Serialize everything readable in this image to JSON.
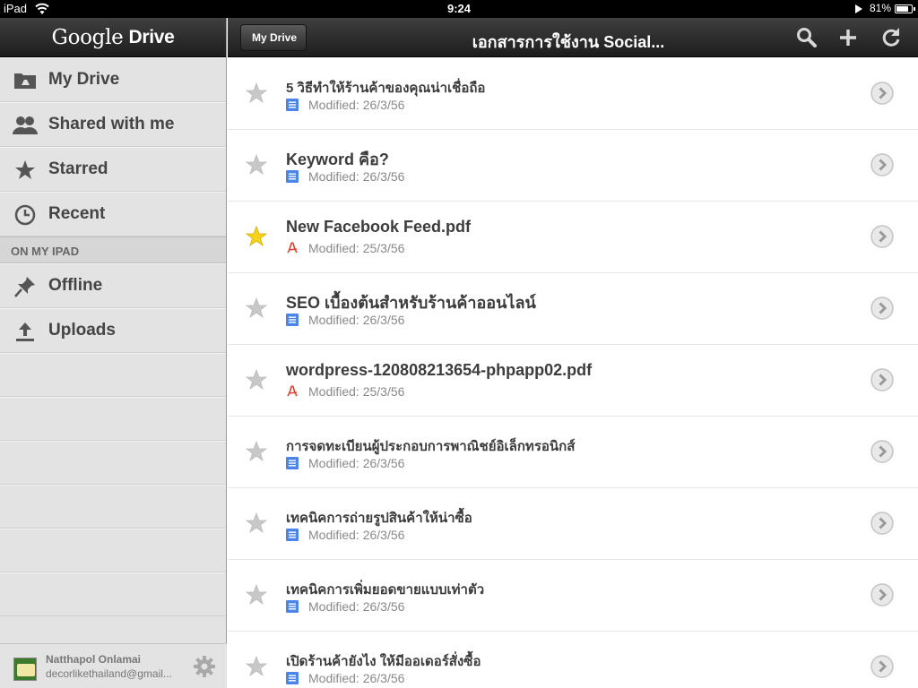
{
  "status": {
    "carrier": "iPad",
    "time": "9:24",
    "battery": "81%",
    "battery_level": 0.81
  },
  "sidebar": {
    "logo_google": "Google",
    "logo_drive": "Drive",
    "items": [
      {
        "label": "My Drive",
        "icon": "drive-folder-icon"
      },
      {
        "label": "Shared with me",
        "icon": "people-icon"
      },
      {
        "label": "Starred",
        "icon": "star-icon"
      },
      {
        "label": "Recent",
        "icon": "clock-icon"
      }
    ],
    "section": "ON MY IPAD",
    "local_items": [
      {
        "label": "Offline",
        "icon": "pin-icon"
      },
      {
        "label": "Uploads",
        "icon": "upload-icon"
      }
    ],
    "user": {
      "name": "Natthapol Onlamai",
      "email": "decorlikethailand@gmail..."
    }
  },
  "topbar": {
    "back_label": "My Drive",
    "title": "เอกสารการใช้งาน Social...",
    "icons": [
      "search-icon",
      "add-icon",
      "refresh-icon"
    ]
  },
  "files": [
    {
      "name": "5 วิธีทำให้ร้านค้าของคุณน่าเชื่อถือ",
      "modified": "Modified: 26/3/56",
      "type": "doc",
      "starred": false,
      "thai": true
    },
    {
      "name": "Keyword คือ?",
      "modified": "Modified: 26/3/56",
      "type": "doc",
      "starred": false,
      "thai": false
    },
    {
      "name": "New Facebook Feed.pdf",
      "modified": "Modified: 25/3/56",
      "type": "pdf",
      "starred": true,
      "thai": false
    },
    {
      "name": "SEO เบื้องต้นสำหรับร้านค้าออนไลน์",
      "modified": "Modified: 26/3/56",
      "type": "doc",
      "starred": false,
      "thai": false
    },
    {
      "name": "wordpress-120808213654-phpapp02.pdf",
      "modified": "Modified: 25/3/56",
      "type": "pdf",
      "starred": false,
      "thai": false
    },
    {
      "name": "การจดทะเบียนผู้ประกอบการพาณิชย์อิเล็กทรอนิกส์",
      "modified": "Modified: 26/3/56",
      "type": "doc",
      "starred": false,
      "thai": true
    },
    {
      "name": "เทคนิคการถ่ายรูปสินค้าให้น่าซื้อ",
      "modified": "Modified: 26/3/56",
      "type": "doc",
      "starred": false,
      "thai": true
    },
    {
      "name": "เทคนิคการเพิ่มยอดขายแบบเท่าตัว",
      "modified": "Modified: 26/3/56",
      "type": "doc",
      "starred": false,
      "thai": true
    },
    {
      "name": "เปิดร้านค้ายังไง ให้มีออเดอร์สั่งซื้อ",
      "modified": "Modified: 26/3/56",
      "type": "doc",
      "starred": false,
      "thai": true
    }
  ],
  "colors": {
    "star_on": "#f7d21c",
    "star_off": "#c8c8c8",
    "doc_blue": "#4a86e8",
    "pdf_red": "#d9432f"
  }
}
